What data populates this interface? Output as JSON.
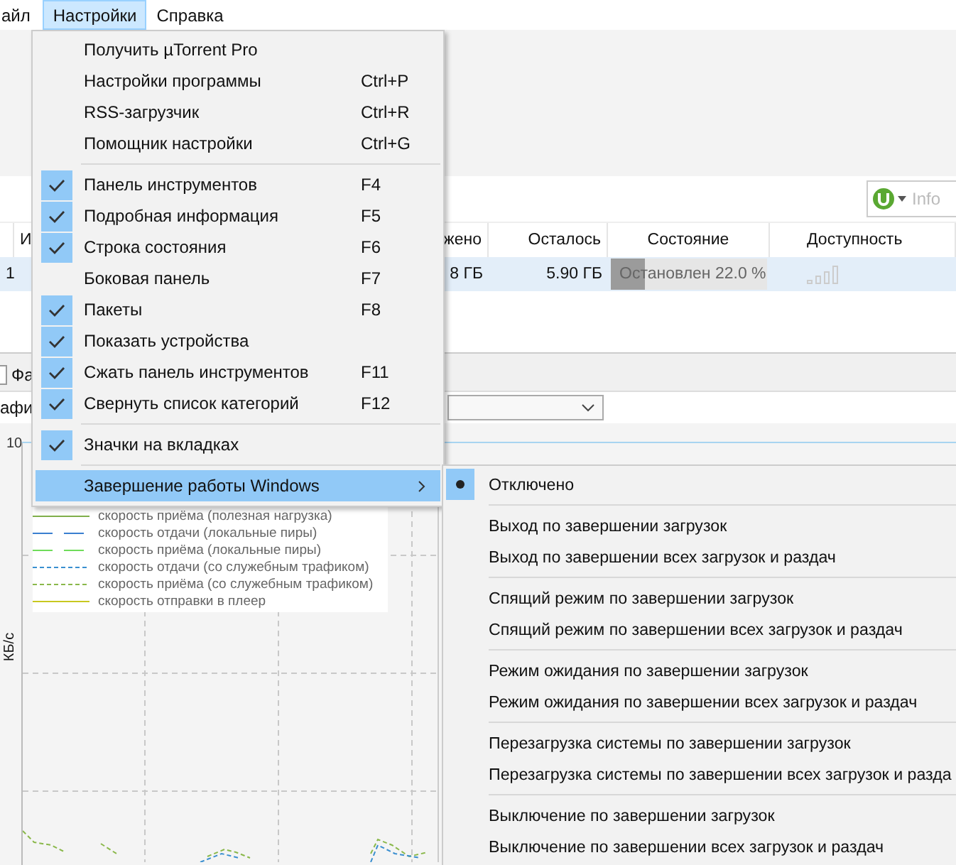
{
  "menubar": [
    {
      "label": "айл",
      "selected": false
    },
    {
      "label": "Настройки",
      "selected": true
    },
    {
      "label": "Справка",
      "selected": false
    }
  ],
  "search": {
    "placeholder": "Info"
  },
  "table": {
    "columns": [
      "И",
      "жено",
      "Осталось",
      "Состояние",
      "Доступность"
    ],
    "rows": [
      {
        "number": "1",
        "done": "8 ГБ",
        "remaining": "5.90 ГБ",
        "status": "Остановлен 22.0 %",
        "level": 0.22,
        "selected": true
      }
    ]
  },
  "lower_panel": {
    "tab": "Фа",
    "toolbar_label": "афи"
  },
  "graph": {
    "ytick": "10",
    "ylabel": "КБ/с",
    "legend": [
      {
        "label": "скорость приёма (полезная нагрузка)",
        "color": "#7fae4a",
        "kind": "solid"
      },
      {
        "label": "скорость отдачи (локальные пиры)",
        "color": "#3a7fd0",
        "kind": "long-dash"
      },
      {
        "label": "скорость приёма (локальные пиры)",
        "color": "#6fdc5a",
        "kind": "long-dash"
      },
      {
        "label": "скорость отдачи (со служебным трафиком)",
        "color": "#3a8fd0",
        "kind": "dash"
      },
      {
        "label": "скорость приёма (со служебным трафиком)",
        "color": "#8ab84a",
        "kind": "dash"
      },
      {
        "label": "скорость отправки в плеер",
        "color": "#c8c820",
        "kind": "solid"
      }
    ]
  },
  "menu": {
    "groups": [
      [
        {
          "label": "Получить µTorrent Pro",
          "checked": false,
          "kind": "plain",
          "selected": false
        },
        {
          "label": "Настройки программы",
          "shortcut": "Ctrl+P",
          "checked": false,
          "kind": "plain",
          "selected": false
        },
        {
          "label": "RSS-загрузчик",
          "shortcut": "Ctrl+R",
          "checked": false,
          "kind": "plain",
          "selected": false
        },
        {
          "label": "Помощник настройки",
          "shortcut": "Ctrl+G",
          "checked": false,
          "kind": "plain",
          "selected": false
        }
      ],
      [
        {
          "label": "Панель инструментов",
          "shortcut": "F4",
          "checked": true,
          "kind": "check",
          "selected": false
        },
        {
          "label": "Подробная информация",
          "shortcut": "F5",
          "checked": true,
          "kind": "check",
          "selected": false
        },
        {
          "label": "Строка состояния",
          "shortcut": "F6",
          "checked": true,
          "kind": "check",
          "selected": false
        },
        {
          "label": "Боковая панель",
          "shortcut": "F7",
          "checked": false,
          "kind": "check",
          "selected": false
        },
        {
          "label": "Пакеты",
          "shortcut": "F8",
          "checked": true,
          "kind": "check",
          "selected": false
        },
        {
          "label": "Показать устройства",
          "checked": true,
          "kind": "check",
          "selected": false
        },
        {
          "label": "Сжать панель инструментов",
          "shortcut": "F11",
          "checked": true,
          "kind": "check",
          "selected": false
        },
        {
          "label": "Свернуть список категорий",
          "shortcut": "F12",
          "checked": true,
          "kind": "check",
          "selected": false
        }
      ],
      [
        {
          "label": "Значки на вкладках",
          "checked": true,
          "kind": "check",
          "selected": false
        }
      ],
      [
        {
          "label": "Завершение работы Windows",
          "checked": false,
          "kind": "submenu",
          "selected": true
        }
      ]
    ]
  },
  "submenu": {
    "groups": [
      [
        {
          "label": "Отключено",
          "selected": true
        }
      ],
      [
        {
          "label": "Выход по завершении загрузок",
          "selected": false
        },
        {
          "label": "Выход по завершении всех загрузок и раздач",
          "selected": false
        }
      ],
      [
        {
          "label": "Спящий режим по завершении загрузок",
          "selected": false
        },
        {
          "label": "Спящий режим по завершении всех загрузок и раздач",
          "selected": false
        }
      ],
      [
        {
          "label": "Режим ожидания по завершении загрузок",
          "selected": false
        },
        {
          "label": "Режим ожидания по завершении всех загрузок и раздач",
          "selected": false
        }
      ],
      [
        {
          "label": "Перезагрузка системы по завершении загрузок",
          "selected": false
        },
        {
          "label": "Перезагрузка системы по завершении всех загрузок и разда",
          "selected": false
        }
      ],
      [
        {
          "label": "Выключение по завершении загрузок",
          "selected": false
        },
        {
          "label": "Выключение по завершении всех загрузок и раздач",
          "selected": false
        }
      ]
    ]
  }
}
